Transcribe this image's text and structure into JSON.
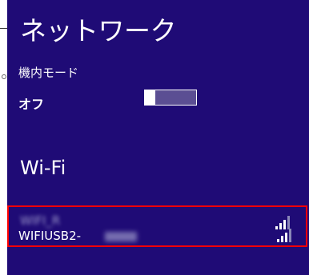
{
  "panel": {
    "title": "ネットワーク",
    "airplane_mode": {
      "label": "機内モード",
      "state": "オフ",
      "on": false
    },
    "wifi_heading": "Wi-Fi",
    "networks": [
      {
        "name": "WIFI_R",
        "signal_bars": 4,
        "selected": true
      },
      {
        "name": "WIFIUSB2-",
        "signal_bars": 4,
        "selected": false
      }
    ],
    "colors": {
      "background": "#1f0b76",
      "highlight": "#ff0000",
      "text": "#ffffff"
    }
  }
}
